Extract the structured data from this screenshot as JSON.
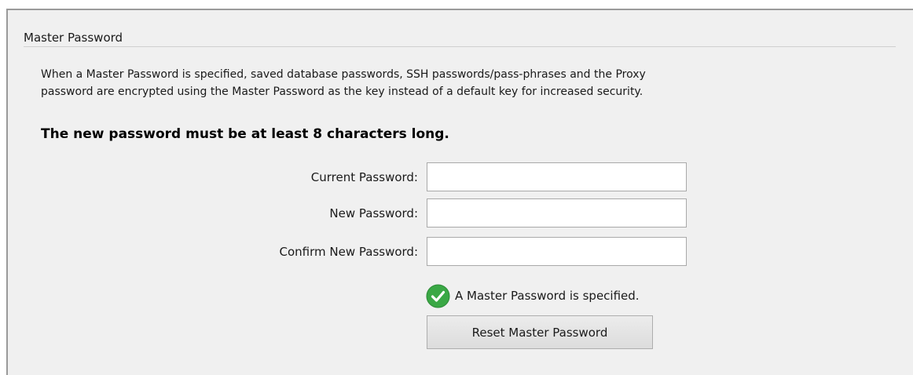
{
  "group": {
    "title": "Master Password"
  },
  "description": {
    "line1": "When a Master Password is specified, saved database passwords, SSH passwords/pass-phrases and the Proxy",
    "line2": "password are encrypted using the Master Password as the key instead of a default key for increased security."
  },
  "requirement": "The new password must be at least 8 characters long.",
  "fields": {
    "current": {
      "label": "Current Password:",
      "value": ""
    },
    "new": {
      "label": "New Password:",
      "value": ""
    },
    "confirm": {
      "label": "Confirm New Password:",
      "value": ""
    }
  },
  "status": {
    "text": "A Master Password is specified.",
    "icon": "check-circle-icon",
    "color": "#3aa845"
  },
  "reset_button": {
    "label": "Reset Master Password"
  }
}
